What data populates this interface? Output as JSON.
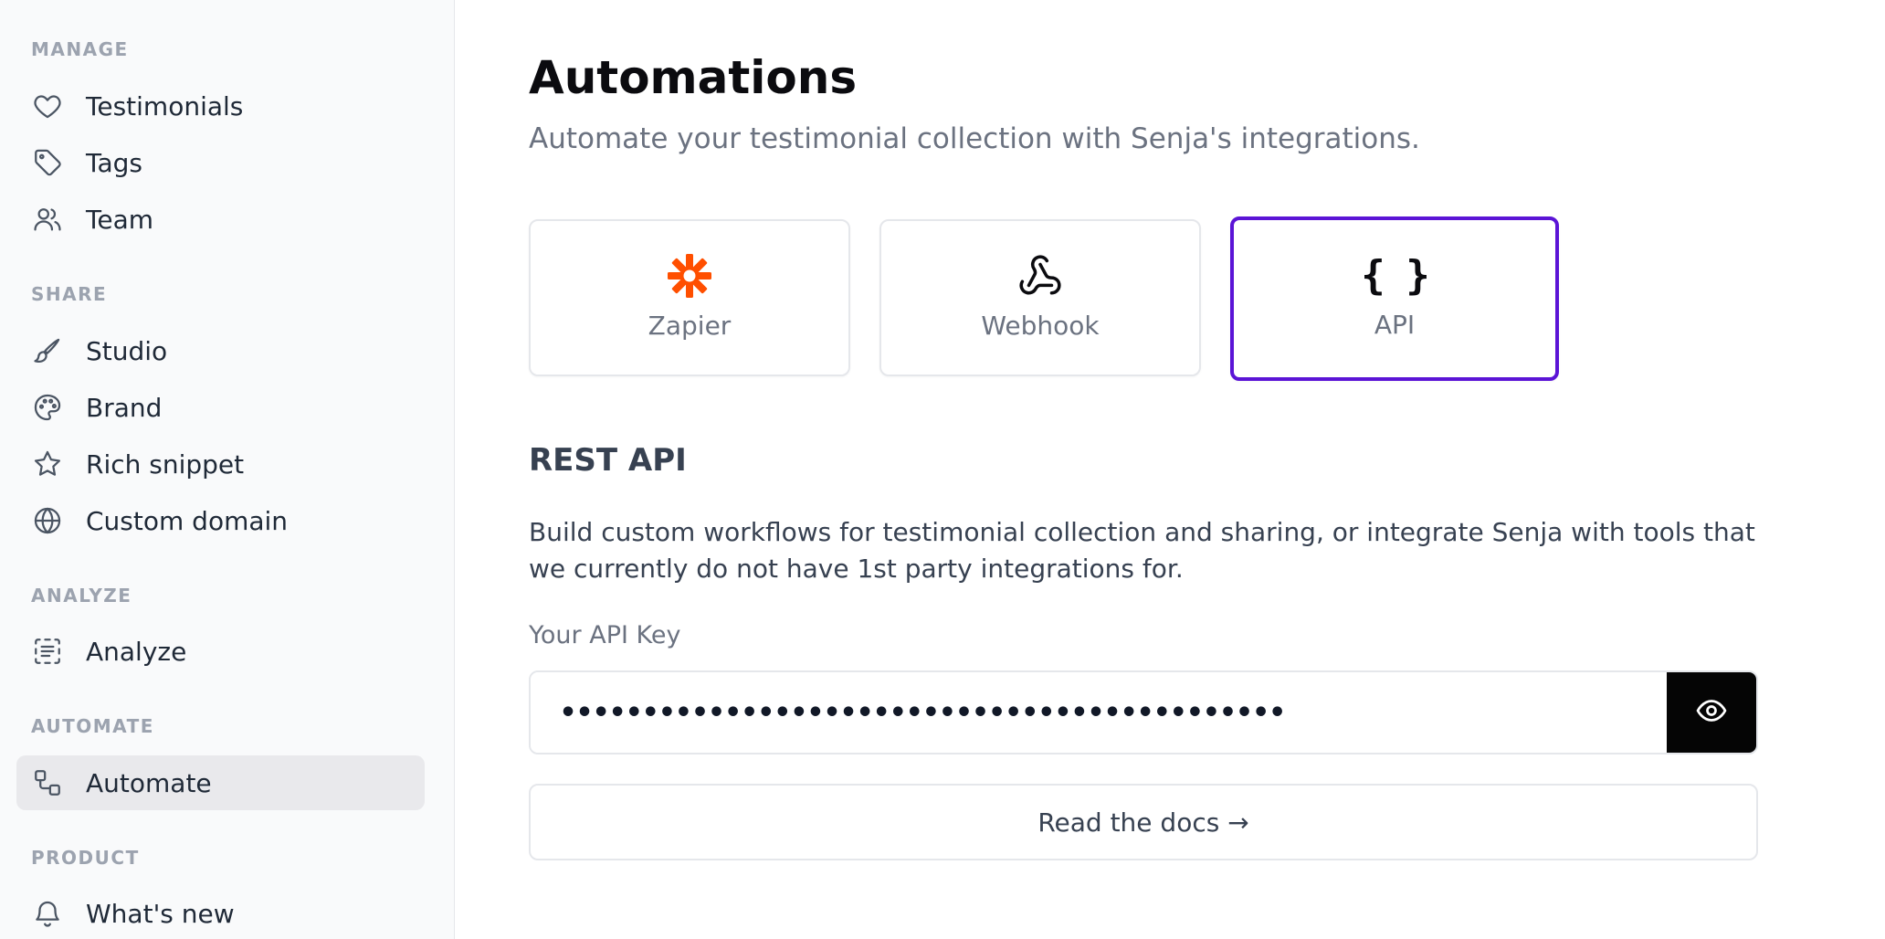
{
  "sidebar": {
    "sections": {
      "manage": "MANAGE",
      "share": "SHARE",
      "analyze": "ANALYZE",
      "automate": "AUTOMATE",
      "product": "PRODUCT"
    },
    "items": {
      "testimonials": "Testimonials",
      "tags": "Tags",
      "team": "Team",
      "studio": "Studio",
      "brand": "Brand",
      "rich_snippet": "Rich snippet",
      "custom_domain": "Custom domain",
      "analyze": "Analyze",
      "automate": "Automate",
      "whats_new": "What's new"
    },
    "active_item": "automate"
  },
  "main": {
    "title": "Automations",
    "subtitle": "Automate your testimonial collection with Senja's integrations.",
    "integrations": [
      {
        "label": "Zapier",
        "icon": "zapier-icon",
        "color": "#ff4f00",
        "selected": false
      },
      {
        "label": "Webhook",
        "icon": "webhook-icon",
        "selected": false
      },
      {
        "label": "API",
        "icon": "braces-icon",
        "selected": true
      }
    ],
    "api_icon_glyph": "{ }",
    "section_heading": "REST API",
    "description": "Build custom workflows for testimonial collection and sharing, or integrate Senja with tools that we currently do not have 1st party integrations for.",
    "api_key_label": "Your API Key",
    "api_key_masked": "••••••••••••••••••••••••••••••••••••••••••••",
    "docs_button": "Read the docs →"
  },
  "colors": {
    "accent": "#5b14d6",
    "zapier": "#ff4f00",
    "eye_button_bg": "#050505"
  }
}
